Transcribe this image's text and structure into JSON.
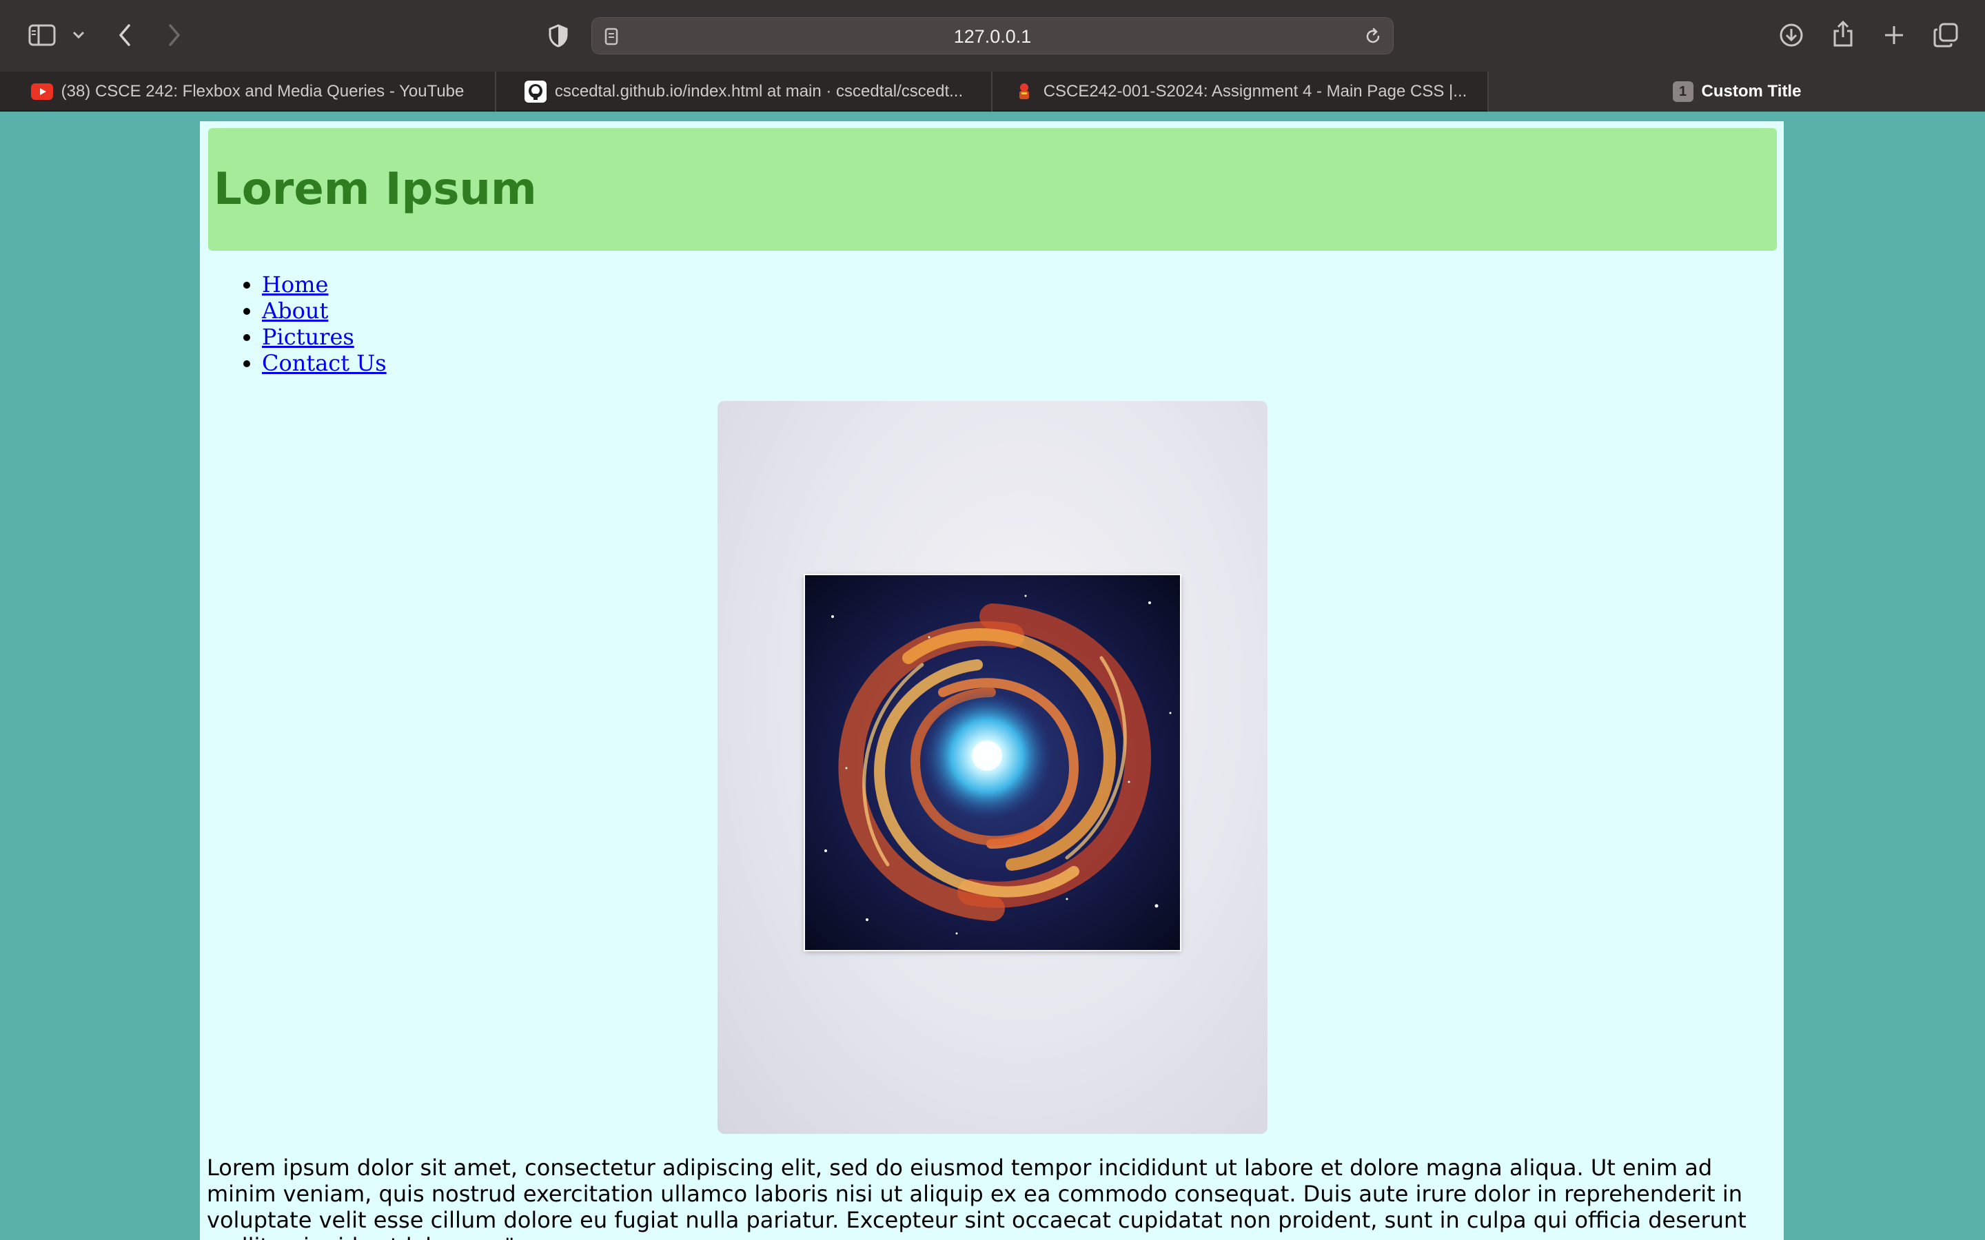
{
  "browser": {
    "url": "127.0.0.1",
    "tabs": [
      {
        "title": "(38) CSCE 242: Flexbox and Media Queries - YouTube",
        "favicon": "youtube-icon"
      },
      {
        "title": "cscedtal.github.io/index.html at main · cscedtal/cscedt...",
        "favicon": "github-icon"
      },
      {
        "title": "CSCE242-001-S2024: Assignment 4 - Main Page CSS |...",
        "favicon": "course-icon"
      },
      {
        "title": "Custom Title",
        "favicon": "tab-count-badge",
        "count": "1",
        "active": true
      }
    ]
  },
  "page": {
    "header_title": "Lorem Ipsum",
    "nav": [
      "Home",
      "About",
      "Pictures",
      "Contact Us"
    ],
    "image_alt": "galaxy-swirl-art",
    "paragraph": "Lorem ipsum dolor sit amet, consectetur adipiscing elit, sed do eiusmod tempor incididunt ut labore et dolore magna aliqua. Ut enim ad minim veniam, quis nostrud exercitation ullamco laboris nisi ut aliquip ex ea commodo consequat. Duis aute irure dolor in reprehenderit in voluptate velit esse cillum dolore eu fugiat nulla pariatur. Excepteur sint occaecat cupidatat non proident, sunt in culpa qui officia deserunt mollit anim id est laborum.\""
  },
  "colors": {
    "page_background": "#59b1aa",
    "content_background": "#e0fefe",
    "header_background": "#a6eb99",
    "header_text": "#2e7d1e",
    "link": "#0000ee"
  }
}
